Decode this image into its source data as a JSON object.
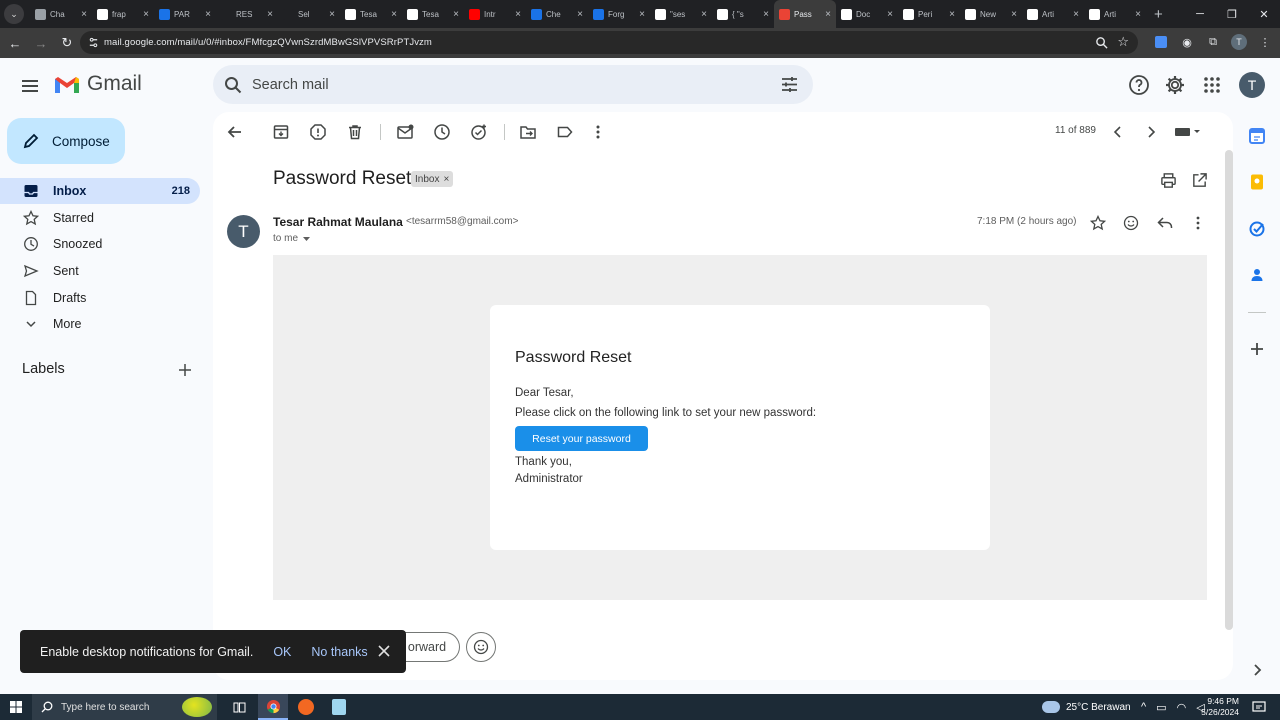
{
  "browser": {
    "tabs": [
      {
        "label": "Cha",
        "color": "#9aa0a6"
      },
      {
        "label": "frap",
        "color": "#ffffff"
      },
      {
        "label": "PAR",
        "color": "#1a73e8"
      },
      {
        "label": "RES",
        "color": "#202124"
      },
      {
        "label": "Sel",
        "color": "#202124"
      },
      {
        "label": "Tesa",
        "color": "#ffffff"
      },
      {
        "label": "Tesa",
        "color": "#ffffff"
      },
      {
        "label": "Intr",
        "color": "#ff0000"
      },
      {
        "label": "Che",
        "color": "#1a73e8"
      },
      {
        "label": "Forg",
        "color": "#1a73e8"
      },
      {
        "label": "\"ses",
        "color": "#ffffff"
      },
      {
        "label": "{ \"s",
        "color": "#ffffff"
      },
      {
        "label": "Pass",
        "color": "#ea4335",
        "active": true
      },
      {
        "label": "Doc",
        "color": "#ffffff"
      },
      {
        "label": "Peri",
        "color": "#ffffff"
      },
      {
        "label": "New",
        "color": "#ffffff"
      },
      {
        "label": "Arti",
        "color": "#ffffff"
      },
      {
        "label": "Arti",
        "color": "#ffffff"
      }
    ],
    "url": "mail.google.com/mail/u/0/#inbox/FMfcgzQVwnSzrdMBwGSlVPVSRrPTJvzm",
    "profile_initial": "T"
  },
  "gmail": {
    "logo_text": "Gmail",
    "search_placeholder": "Search mail",
    "avatar_initial": "T",
    "compose_label": "Compose",
    "nav": [
      {
        "label": "Inbox",
        "count": "218",
        "icon": "inbox-icon",
        "active": true
      },
      {
        "label": "Starred",
        "icon": "star-icon"
      },
      {
        "label": "Snoozed",
        "icon": "clock-icon"
      },
      {
        "label": "Sent",
        "icon": "send-icon"
      },
      {
        "label": "Drafts",
        "icon": "draft-icon"
      },
      {
        "label": "More",
        "icon": "chevron-down-icon"
      }
    ],
    "labels_heading": "Labels",
    "pager": "11 of 889",
    "subject": "Password Reset",
    "chip": "Inbox",
    "sender_initial": "T",
    "sender_name": "Tesar Rahmat Maulana",
    "sender_email": "<tesarrm58@gmail.com>",
    "to": "to me",
    "time": "7:18 PM (2 hours ago)",
    "mail": {
      "title": "Password Reset",
      "greeting": "Dear Tesar,",
      "line": "Please click on the following link to set your new password:",
      "button": "Reset your password",
      "thanks": "Thank you,",
      "signature": "Administrator"
    },
    "forward_label": "orward",
    "toast": {
      "message": "Enable desktop notifications for Gmail.",
      "ok": "OK",
      "no": "No thanks"
    }
  },
  "taskbar": {
    "search_placeholder": "Type here to search",
    "weather": "25°C  Berawan",
    "time": "9:46 PM",
    "date": "5/26/2024"
  }
}
